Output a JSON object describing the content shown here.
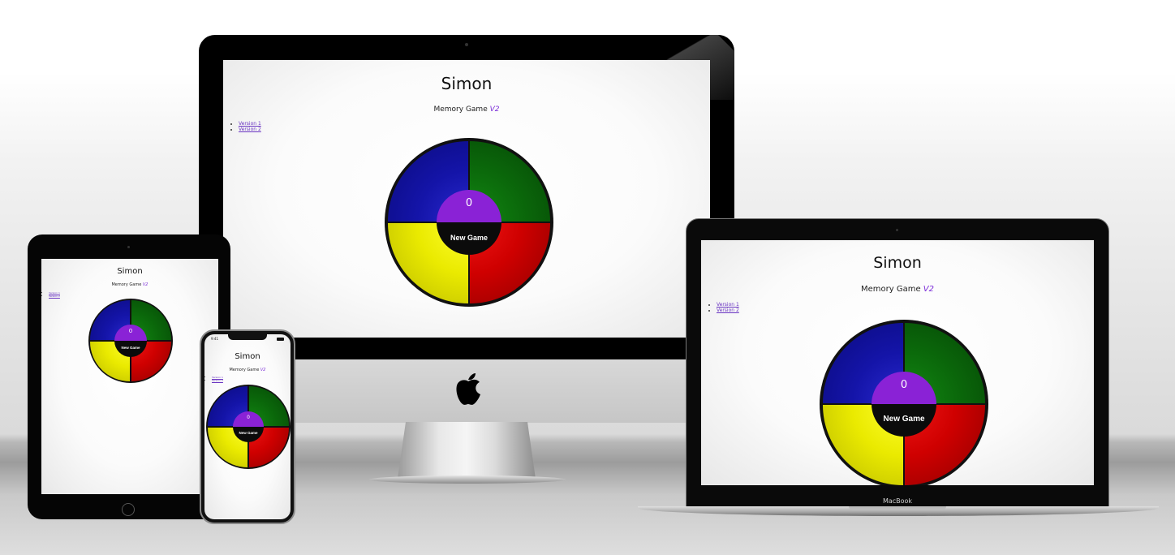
{
  "app": {
    "title": "Simon",
    "subtitle_text": "Memory Game",
    "subtitle_version": "V2",
    "links": [
      "Version 1",
      "Version 2"
    ],
    "score": "0",
    "new_game_label": "New Game"
  },
  "devices": {
    "iphone_status_time": "9:41",
    "macbook_label": "MacBook"
  },
  "colors": {
    "blue": "#1414a8",
    "green": "#0b6a0b",
    "yellow": "#eaea00",
    "red": "#cf0000",
    "score_bg": "#8a22d6",
    "center_bg": "#0b0b0b",
    "version_accent": "#7b2dd8"
  },
  "icons": {
    "apple": "apple-logo-icon",
    "camera": "camera-icon",
    "home_button": "home-button-icon"
  }
}
